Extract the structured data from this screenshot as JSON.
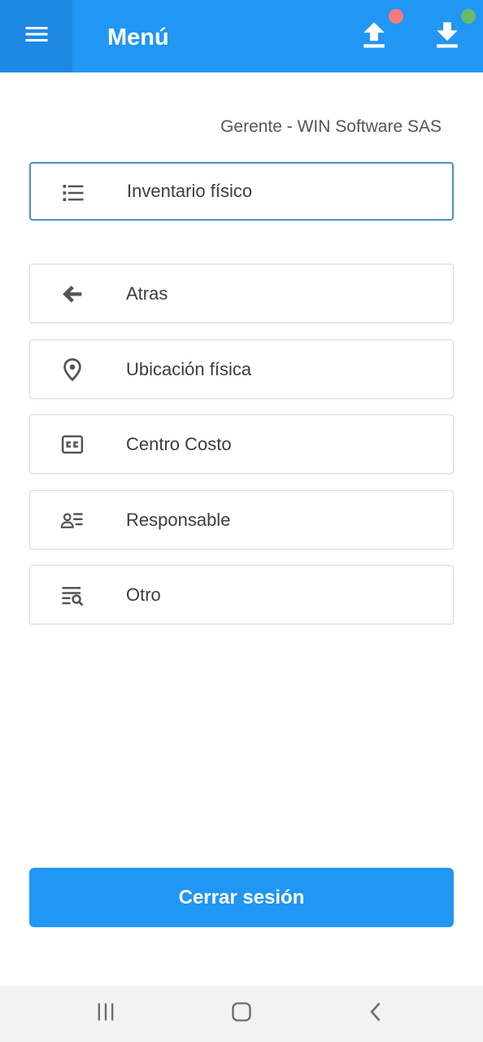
{
  "appbar": {
    "title": "Menú",
    "menu_icon": "hamburger-menu-icon",
    "upload_icon": "upload-icon",
    "download_icon": "download-icon",
    "indicator_colors": {
      "upload": "#f47c7c",
      "download": "#66bb6a"
    },
    "accent": "#2196f3"
  },
  "user": {
    "subtitle": "Gerente - WIN Software SAS"
  },
  "menu": {
    "selected": {
      "label": "Inventario físico",
      "icon": "list-icon"
    },
    "items": [
      {
        "label": "Atras",
        "icon": "arrow-left-icon"
      },
      {
        "label": "Ubicación física",
        "icon": "location-pin-icon"
      },
      {
        "label": "Centro Costo",
        "icon": "closed-caption-icon"
      },
      {
        "label": "Responsable",
        "icon": "person-list-icon"
      },
      {
        "label": "Otro",
        "icon": "list-search-icon"
      }
    ]
  },
  "logout": {
    "label": "Cerrar sesión"
  },
  "system_nav": {
    "recents": "recents-icon",
    "home": "home-icon",
    "back": "back-icon"
  }
}
